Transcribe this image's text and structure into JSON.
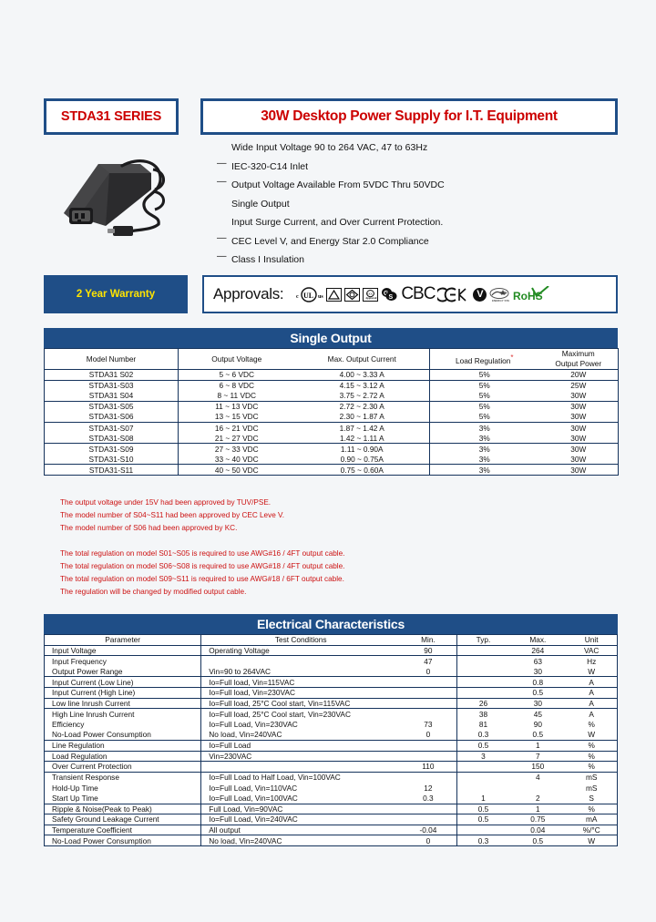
{
  "header": {
    "series": "STDA31 SERIES",
    "title": "30W Desktop Power Supply for I.T. Equipment"
  },
  "features": [
    {
      "dash": false,
      "text": "Wide Input Voltage 90 to 264 VAC, 47 to 63Hz"
    },
    {
      "dash": true,
      "text": "IEC-320-C14 Inlet"
    },
    {
      "dash": true,
      "text": "Output Voltage Available From 5VDC Thru 50VDC"
    },
    {
      "dash": false,
      "text": "Single Output"
    },
    {
      "dash": false,
      "text": "Input Surge Current, and Over Current Protection."
    },
    {
      "dash": true,
      "text": "CEC Level V, and Energy Star 2.0 Compliance"
    },
    {
      "dash": true,
      "text": "Class I Insulation"
    }
  ],
  "warranty": {
    "label": "2 Year Warranty"
  },
  "approvals": {
    "label": "Approvals:",
    "marks": [
      "cULus",
      "TUV-triangle",
      "PSE-diamond",
      "CCC-round",
      "GS",
      "CB",
      "CE",
      "KC",
      "V-mark",
      "EnergyStar",
      "RoHS"
    ],
    "cb_text": "CBC",
    "ce_text": "C€K",
    "v_text": "V",
    "rohs_text": "RoHS"
  },
  "single_output": {
    "section_title": "Single Output",
    "columns": [
      "Model Number",
      "Output Voltage",
      "Max. Output Current",
      "Load Regulation",
      "Maximum",
      "Output Power"
    ],
    "col_load_reg": "Load Regulation",
    "col_max_line1": "Maximum",
    "col_max_line2": "Output Power",
    "rows": [
      {
        "model": "STDA31 S02",
        "voltage": "5 ~ 6 VDC",
        "current": "4.00 ~ 3.33 A",
        "load_reg": "5%",
        "power": "20W",
        "sep": true
      },
      {
        "model": "STDA31-S03",
        "voltage": "6 ~ 8 VDC",
        "current": "4.15 ~ 3.12 A",
        "load_reg": "5%",
        "power": "25W",
        "sep": false
      },
      {
        "model": "STDA31 S04",
        "voltage": "8 ~ 11 VDC",
        "current": "3.75 ~ 2.72 A",
        "load_reg": "5%",
        "power": "30W",
        "sep": true
      },
      {
        "model": "STDA31-S05",
        "voltage": "11 ~ 13 VDC",
        "current": "2.72 ~ 2.30 A",
        "load_reg": "5%",
        "power": "30W",
        "sep": false
      },
      {
        "model": "STDA31-S06",
        "voltage": "13 ~ 15 VDC",
        "current": "2.30 ~ 1.87 A",
        "load_reg": "5%",
        "power": "30W",
        "sep": true
      },
      {
        "model": "STDA31-S07",
        "voltage": "16 ~ 21 VDC",
        "current": "1.87 ~ 1.42 A",
        "load_reg": "3%",
        "power": "30W",
        "sep": false
      },
      {
        "model": "STDA31-S08",
        "voltage": "21 ~ 27 VDC",
        "current": "1.42 ~ 1.11 A",
        "load_reg": "3%",
        "power": "30W",
        "sep": true
      },
      {
        "model": "STDA31-S09",
        "voltage": "27 ~ 33 VDC",
        "current": "1.11 ~ 0.90A",
        "load_reg": "3%",
        "power": "30W",
        "sep": false
      },
      {
        "model": "STDA31-S10",
        "voltage": "33 ~ 40 VDC",
        "current": "0.90 ~ 0.75A",
        "load_reg": "3%",
        "power": "30W",
        "sep": true
      },
      {
        "model": "STDA31-S11",
        "voltage": "40 ~ 50 VDC",
        "current": "0.75 ~ 0.60A",
        "load_reg": "3%",
        "power": "30W",
        "sep": true
      }
    ]
  },
  "notes": [
    "The output voltage under 15V had been approved by TUV/PSE.",
    "The model number of S04~S11 had been approved by CEC Leve V.",
    "The model number of S06 had been approved by KC."
  ],
  "notes2": [
    "The total regulation on model S01~S05 is required to use AWG#16 / 4FT output cable.",
    "The total regulation on model S06~S08 is required to use AWG#18 / 4FT output cable.",
    "The total regulation on model S09~S11 is required to use AWG#18 / 6FT output cable.",
    "The regulation will be changed by modified output cable."
  ],
  "electrical": {
    "section_title": "Electrical Characteristics",
    "columns": [
      "Parameter",
      "Test Conditions",
      "Min.",
      "Typ.",
      "Max.",
      "Unit"
    ],
    "rows": [
      {
        "param": "Input Voltage",
        "cond": "Operating Voltage",
        "min": "90",
        "typ": "",
        "max": "264",
        "unit": "VAC",
        "sep": true
      },
      {
        "param": "Input Frequency",
        "cond": "",
        "min": "47",
        "typ": "",
        "max": "63",
        "unit": "Hz",
        "sep": false
      },
      {
        "param": "Output Power Range",
        "cond": "Vin=90 to 264VAC",
        "min": "0",
        "typ": "",
        "max": "30",
        "unit": "W",
        "sep": true
      },
      {
        "param": "Input Current (Low Line)",
        "cond": "Io=Full load, Vin=115VAC",
        "min": "",
        "typ": "",
        "max": "0.8",
        "unit": "A",
        "sep": true
      },
      {
        "param": "Input Current (High Line)",
        "cond": "Io=Full load, Vin=230VAC",
        "min": "",
        "typ": "",
        "max": "0.5",
        "unit": "A",
        "sep": true
      },
      {
        "param": "Low line Inrush Current",
        "cond": "Io=Full load, 25°C Cool start, Vin=115VAC",
        "min": "",
        "typ": "26",
        "max": "30",
        "unit": "A",
        "sep": true
      },
      {
        "param": "High Line Inrush Current",
        "cond": "Io=Full load, 25°C Cool start, Vin=230VAC",
        "min": "",
        "typ": "38",
        "max": "45",
        "unit": "A",
        "sep": false
      },
      {
        "param": "Efficiency",
        "cond": "Io=Full Load, Vin=230VAC",
        "min": "73",
        "typ": "81",
        "max": "90",
        "unit": "%",
        "sep": false
      },
      {
        "param": "No-Load Power Consumption",
        "cond": "No load, Vin=240VAC",
        "min": "0",
        "typ": "0.3",
        "max": "0.5",
        "unit": "W",
        "sep": true
      },
      {
        "param": "Line Regulation",
        "cond": "Io=Full Load",
        "min": "",
        "typ": "0.5",
        "max": "1",
        "unit": "%",
        "sep": true
      },
      {
        "param": "Load Regulation",
        "cond": "Vin=230VAC",
        "min": "",
        "typ": "3",
        "max": "7",
        "unit": "%",
        "sep": true
      },
      {
        "param": "Over Current Protection",
        "cond": "",
        "min": "110",
        "typ": "",
        "max": "150",
        "unit": "%",
        "sep": true
      },
      {
        "param": "Transient Response",
        "cond": "Io=Full Load to Half Load, Vin=100VAC",
        "min": "",
        "typ": "",
        "max": "4",
        "unit": "mS",
        "sep": false
      },
      {
        "param": "Hold-Up Time",
        "cond": "Io=Full Load, Vin=110VAC",
        "min": "12",
        "typ": "",
        "max": "",
        "unit": "mS",
        "sep": false
      },
      {
        "param": "Start Up Time",
        "cond": "Io=Full Load, Vin=100VAC",
        "min": "0.3",
        "typ": "1",
        "max": "2",
        "unit": "S",
        "sep": true
      },
      {
        "param": "Ripple & Noise(Peak to Peak)",
        "cond": "Full Load, Vin=90VAC",
        "min": "",
        "typ": "0.5",
        "max": "1",
        "unit": "%",
        "sep": true
      },
      {
        "param": "Safety Ground Leakage Current",
        "cond": "Io=Full Load, Vin=240VAC",
        "min": "",
        "typ": "0.5",
        "max": "0.75",
        "unit": "mA",
        "sep": true
      },
      {
        "param": "Temperature Coefficient",
        "cond": "All output",
        "min": "-0.04",
        "typ": "",
        "max": "0.04",
        "unit": "%/°C",
        "sep": true
      },
      {
        "param": "No-Load Power Consumption",
        "cond": "No load, Vin=240VAC",
        "min": "0",
        "typ": "0.3",
        "max": "0.5",
        "unit": "W",
        "sep": true
      }
    ]
  }
}
